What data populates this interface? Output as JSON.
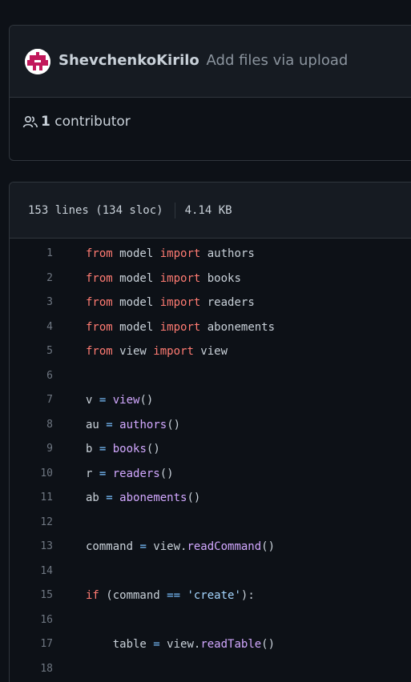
{
  "commit": {
    "author": "ShevchenkoKirilo",
    "message": "Add files via upload"
  },
  "contributors": {
    "count": "1",
    "label": "contributor"
  },
  "file": {
    "lines": "153 lines (134 sloc)",
    "size": "4.14 KB"
  },
  "icons": {
    "avatar": "avatar-icon",
    "contributors": "people-icon"
  },
  "colors": {
    "background": "#0d1117",
    "header": "#161b22",
    "border": "#30363d",
    "keyword": "#ff7b72",
    "function": "#d2a8ff",
    "operator": "#79c0ff",
    "string": "#a5d6ff",
    "line_number": "#6e7681"
  },
  "code": {
    "lines": [
      {
        "n": "1",
        "tokens": [
          [
            "kw",
            "from"
          ],
          [
            "t",
            " model "
          ],
          [
            "kw",
            "import"
          ],
          [
            "t",
            " authors"
          ]
        ]
      },
      {
        "n": "2",
        "tokens": [
          [
            "kw",
            "from"
          ],
          [
            "t",
            " model "
          ],
          [
            "kw",
            "import"
          ],
          [
            "t",
            " books"
          ]
        ]
      },
      {
        "n": "3",
        "tokens": [
          [
            "kw",
            "from"
          ],
          [
            "t",
            " model "
          ],
          [
            "kw",
            "import"
          ],
          [
            "t",
            " readers"
          ]
        ]
      },
      {
        "n": "4",
        "tokens": [
          [
            "kw",
            "from"
          ],
          [
            "t",
            " model "
          ],
          [
            "kw",
            "import"
          ],
          [
            "t",
            " abonements"
          ]
        ]
      },
      {
        "n": "5",
        "tokens": [
          [
            "kw",
            "from"
          ],
          [
            "t",
            " view "
          ],
          [
            "kw",
            "import"
          ],
          [
            "t",
            " view"
          ]
        ]
      },
      {
        "n": "6",
        "tokens": []
      },
      {
        "n": "7",
        "tokens": [
          [
            "t",
            "v "
          ],
          [
            "op",
            "="
          ],
          [
            "t",
            " "
          ],
          [
            "fn",
            "view"
          ],
          [
            "t",
            "()"
          ]
        ]
      },
      {
        "n": "8",
        "tokens": [
          [
            "t",
            "au "
          ],
          [
            "op",
            "="
          ],
          [
            "t",
            " "
          ],
          [
            "fn",
            "authors"
          ],
          [
            "t",
            "()"
          ]
        ]
      },
      {
        "n": "9",
        "tokens": [
          [
            "t",
            "b "
          ],
          [
            "op",
            "="
          ],
          [
            "t",
            " "
          ],
          [
            "fn",
            "books"
          ],
          [
            "t",
            "()"
          ]
        ]
      },
      {
        "n": "10",
        "tokens": [
          [
            "t",
            "r "
          ],
          [
            "op",
            "="
          ],
          [
            "t",
            " "
          ],
          [
            "fn",
            "readers"
          ],
          [
            "t",
            "()"
          ]
        ]
      },
      {
        "n": "11",
        "tokens": [
          [
            "t",
            "ab "
          ],
          [
            "op",
            "="
          ],
          [
            "t",
            " "
          ],
          [
            "fn",
            "abonements"
          ],
          [
            "t",
            "()"
          ]
        ]
      },
      {
        "n": "12",
        "tokens": []
      },
      {
        "n": "13",
        "tokens": [
          [
            "t",
            "command "
          ],
          [
            "op",
            "="
          ],
          [
            "t",
            " view."
          ],
          [
            "fn",
            "readCommand"
          ],
          [
            "t",
            "()"
          ]
        ]
      },
      {
        "n": "14",
        "tokens": []
      },
      {
        "n": "15",
        "tokens": [
          [
            "kw",
            "if"
          ],
          [
            "t",
            " (command "
          ],
          [
            "op",
            "=="
          ],
          [
            "t",
            " "
          ],
          [
            "str",
            "'create'"
          ],
          [
            "t",
            "):"
          ]
        ]
      },
      {
        "n": "16",
        "tokens": []
      },
      {
        "n": "17",
        "tokens": [
          [
            "t",
            "    table "
          ],
          [
            "op",
            "="
          ],
          [
            "t",
            " view."
          ],
          [
            "fn",
            "readTable"
          ],
          [
            "t",
            "()"
          ]
        ]
      },
      {
        "n": "18",
        "tokens": []
      }
    ]
  }
}
